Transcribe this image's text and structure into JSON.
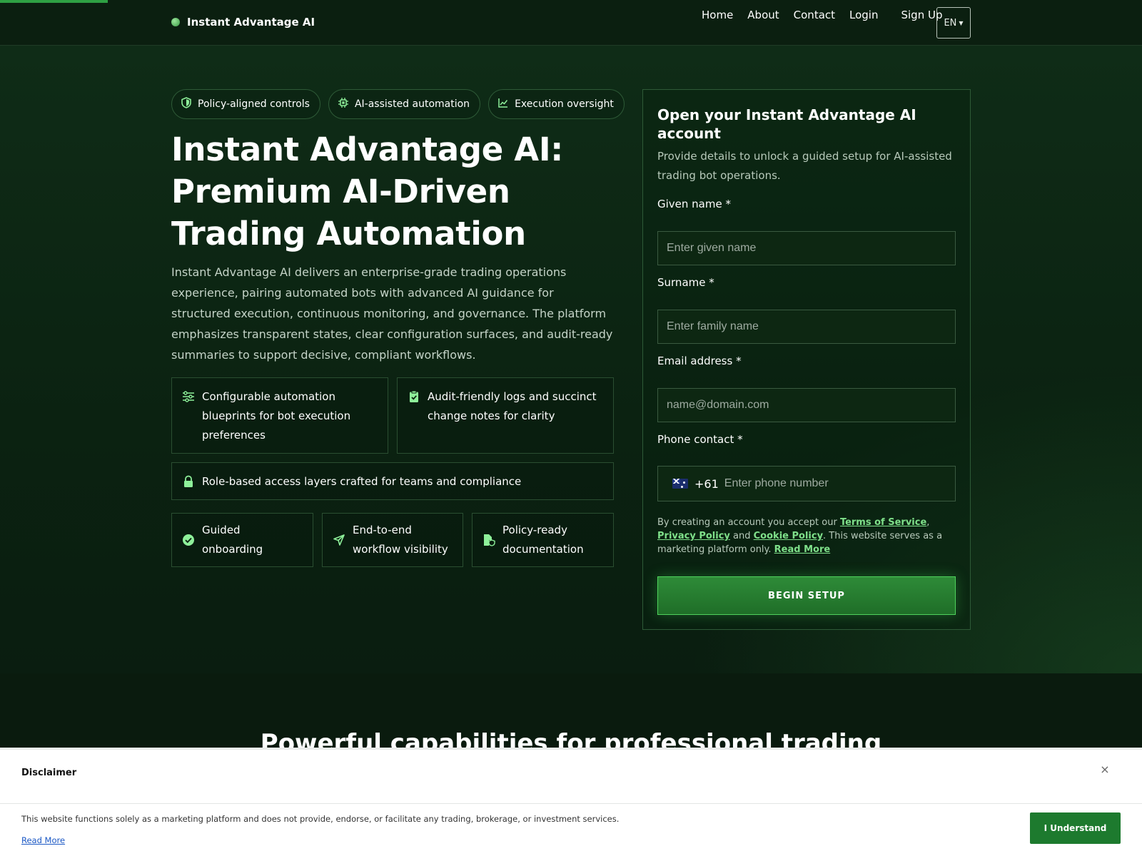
{
  "header": {
    "brand": "Instant Advantage AI",
    "nav": [
      "Home",
      "About",
      "Contact",
      "Login",
      "Sign Up"
    ],
    "language": "EN"
  },
  "hero": {
    "pills": [
      "Policy-aligned controls",
      "AI-assisted automation",
      "Execution oversight"
    ],
    "title": "Instant Advantage AI: Premium AI-Driven Trading Automation",
    "description": "Instant Advantage AI delivers an enterprise-grade trading operations experience, pairing automated bots with advanced AI guidance for structured execution, continuous monitoring, and governance. The platform emphasizes transparent states, clear configuration surfaces, and audit-ready summaries to support decisive, compliant workflows.",
    "features": [
      "Configurable automation blueprints for bot execution preferences",
      "Audit-friendly logs and succinct change notes for clarity",
      "Role-based access layers crafted for teams and compliance"
    ],
    "highlights": [
      "Guided onboarding",
      "End-to-end workflow visibility",
      "Policy-ready documentation"
    ]
  },
  "form": {
    "title": "Open your Instant Advantage AI account",
    "subtitle": "Provide details to unlock a guided setup for AI-assisted trading bot operations.",
    "given_name_label": "Given name *",
    "given_name_placeholder": "Enter given name",
    "surname_label": "Surname *",
    "surname_placeholder": "Enter family name",
    "email_label": "Email address *",
    "email_placeholder": "name@domain.com",
    "phone_label": "Phone contact *",
    "phone_code": "+61",
    "phone_placeholder": "Enter phone number",
    "consent_prefix": "By creating an account you accept our ",
    "terms_link": "Terms of Service",
    "comma": ", ",
    "privacy_link": "Privacy Policy",
    "and_text": " and ",
    "cookie_link": "Cookie Policy",
    "consent_suffix": ". This website serves as a marketing platform only. ",
    "read_more_link": "Read More",
    "submit": "BEGIN SETUP"
  },
  "section": {
    "heading": "Powerful capabilities for professional trading"
  },
  "disclaimer": {
    "title": "Disclaimer",
    "close": "×",
    "text": "This website functions solely as a marketing platform and does not provide, endorse, or facilitate any trading, brokerage, or investment services.",
    "read_more": "Read More",
    "button": "I Understand"
  },
  "colors": {
    "accent": "#2ea043",
    "link": "#7fe08a",
    "background": "#0a1d10",
    "disclaimer_button": "#1d7a2e"
  },
  "icons": {
    "pills": [
      "shield-icon",
      "chip-icon",
      "chart-line-icon"
    ],
    "features": [
      "sliders-icon",
      "clipboard-check-icon",
      "lock-icon"
    ],
    "highlights": [
      "check-circle-icon",
      "send-icon",
      "file-shield-icon"
    ]
  }
}
